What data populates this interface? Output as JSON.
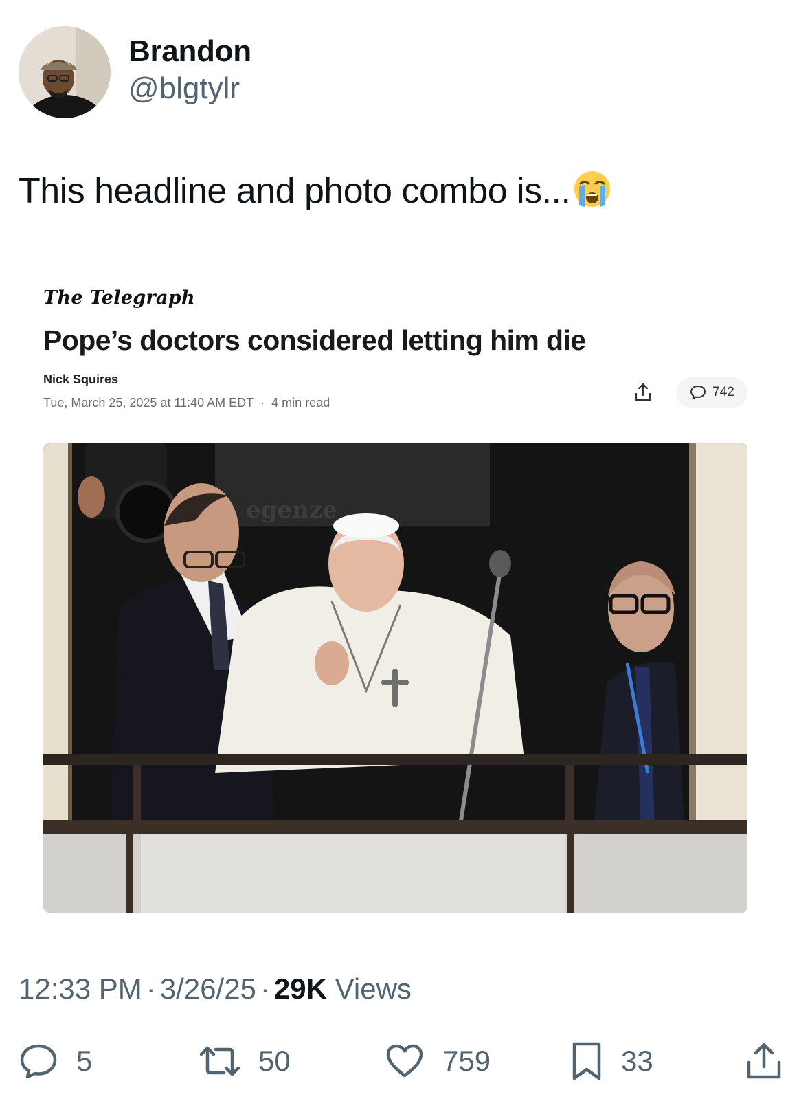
{
  "author": {
    "display_name": "Brandon",
    "handle": "@blgtylr"
  },
  "tweet": {
    "text": "This headline and photo combo is...",
    "emoji": "loudly-crying-face-icon"
  },
  "article": {
    "publication": "The Telegraph",
    "headline": "Pope’s doctors considered letting him die",
    "byline": "Nick Squires",
    "date": "Tue, March 25, 2025 at 11:40 AM EDT",
    "separator": "·",
    "read_time": "4 min read",
    "comment_count": "742",
    "photo_text": "egenze"
  },
  "meta": {
    "time": "12:33 PM",
    "separator": "·",
    "date": "3/26/25",
    "views_count": "29K",
    "views_label": "Views"
  },
  "actions": {
    "replies": "5",
    "reposts": "50",
    "likes": "759",
    "bookmarks": "33"
  },
  "colors": {
    "text_primary": "#0f1419",
    "text_secondary": "#536471",
    "background": "#ffffff"
  }
}
